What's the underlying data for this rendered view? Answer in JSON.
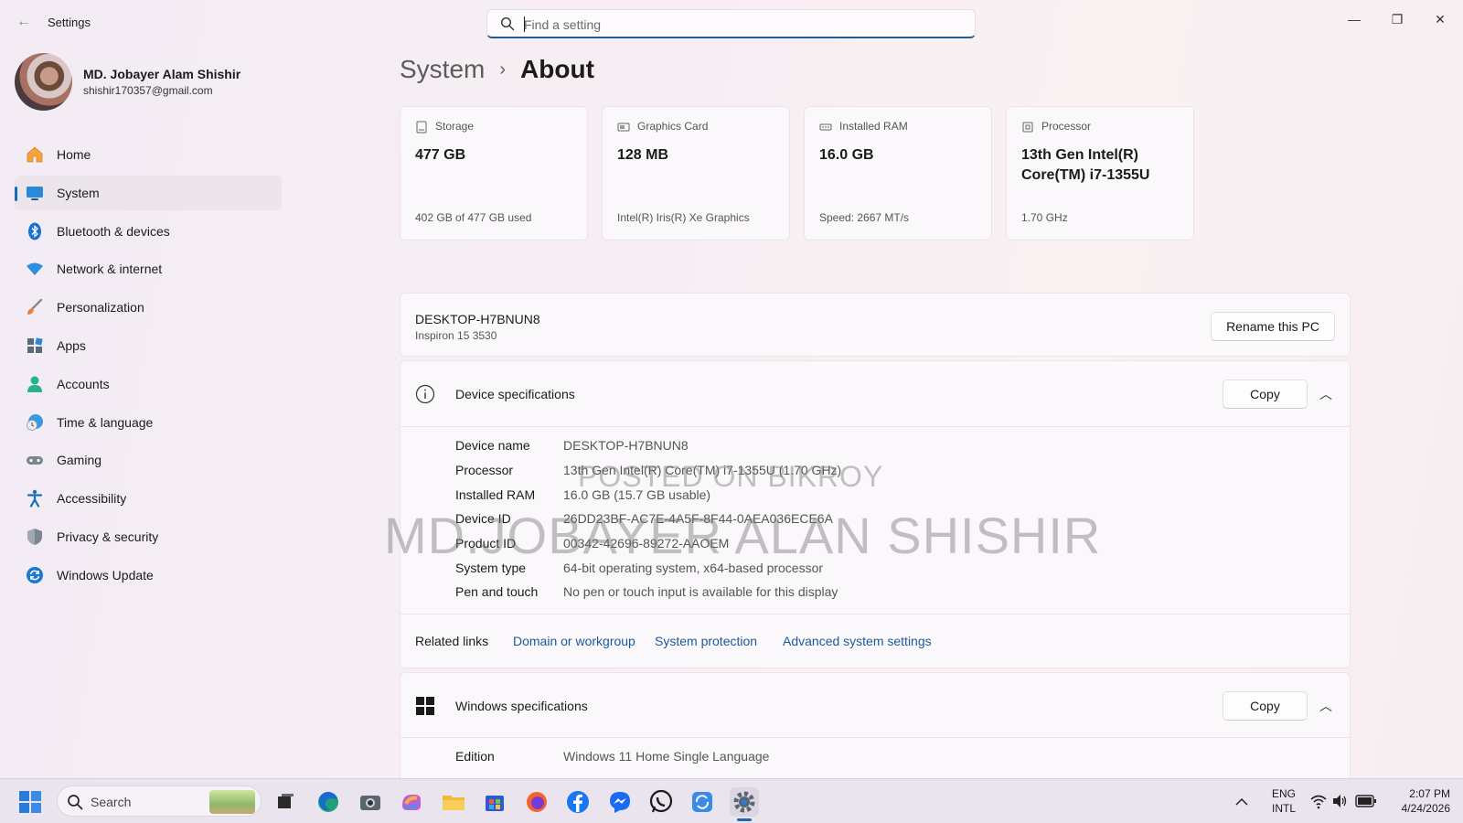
{
  "window": {
    "app_title": "Settings",
    "controls": {
      "minimize": "—",
      "maximize": "❐",
      "close": "✕"
    }
  },
  "search": {
    "placeholder": "Find a setting"
  },
  "profile": {
    "name": "MD. Jobayer Alam Shishir",
    "email": "shishir170357@gmail.com"
  },
  "sidebar": {
    "items": [
      {
        "label": "Home",
        "icon": "home-icon",
        "active": false
      },
      {
        "label": "System",
        "icon": "system-icon",
        "active": true
      },
      {
        "label": "Bluetooth & devices",
        "icon": "bluetooth-icon",
        "active": false
      },
      {
        "label": "Network & internet",
        "icon": "wifi-icon",
        "active": false
      },
      {
        "label": "Personalization",
        "icon": "brush-icon",
        "active": false
      },
      {
        "label": "Apps",
        "icon": "apps-icon",
        "active": false
      },
      {
        "label": "Accounts",
        "icon": "accounts-icon",
        "active": false
      },
      {
        "label": "Time & language",
        "icon": "clock-globe-icon",
        "active": false
      },
      {
        "label": "Gaming",
        "icon": "gamepad-icon",
        "active": false
      },
      {
        "label": "Accessibility",
        "icon": "accessibility-icon",
        "active": false
      },
      {
        "label": "Privacy & security",
        "icon": "shield-icon",
        "active": false
      },
      {
        "label": "Windows Update",
        "icon": "update-icon",
        "active": false
      }
    ]
  },
  "breadcrumb": {
    "parent": "System",
    "separator": "›",
    "current": "About"
  },
  "tiles": [
    {
      "label": "Storage",
      "icon": "storage-icon",
      "value": "477 GB",
      "sub": "402 GB of 477 GB used"
    },
    {
      "label": "Graphics Card",
      "icon": "graphics-card-icon",
      "value": "128 MB",
      "sub": "Intel(R) Iris(R) Xe Graphics"
    },
    {
      "label": "Installed RAM",
      "icon": "ram-icon",
      "value": "16.0 GB",
      "sub": "Speed: 2667 MT/s"
    },
    {
      "label": "Processor",
      "icon": "processor-icon",
      "value": "13th Gen Intel(R) Core(TM) i7-1355U",
      "sub": "1.70 GHz"
    }
  ],
  "pc": {
    "name": "DESKTOP-H7BNUN8",
    "model": "Inspiron 15 3530",
    "rename_label": "Rename this PC"
  },
  "device_specs": {
    "title": "Device specifications",
    "copy_label": "Copy",
    "rows": [
      {
        "key": "Device name",
        "value": "DESKTOP-H7BNUN8"
      },
      {
        "key": "Processor",
        "value": "13th Gen Intel(R) Core(TM) i7-1355U (1.70 GHz)"
      },
      {
        "key": "Installed RAM",
        "value": "16.0 GB (15.7 GB usable)"
      },
      {
        "key": "Device ID",
        "value": "26DD23BF-AC7E-4A5F-8F44-0AEA036ECE6A"
      },
      {
        "key": "Product ID",
        "value": "00342-42696-89272-AAOEM"
      },
      {
        "key": "System type",
        "value": "64-bit operating system, x64-based processor"
      },
      {
        "key": "Pen and touch",
        "value": "No pen or touch input is available for this display"
      }
    ]
  },
  "related_links": {
    "label": "Related links",
    "links": [
      "Domain or workgroup",
      "System protection",
      "Advanced system settings"
    ]
  },
  "windows_specs": {
    "title": "Windows specifications",
    "copy_label": "Copy",
    "rows": [
      {
        "key": "Edition",
        "value": "Windows 11 Home Single Language"
      }
    ]
  },
  "watermarks": {
    "line1": "POSTED ON BIKROY",
    "line2": "MD.JOBAYER ALAN SHISHIR"
  },
  "taskbar": {
    "search_label": "Search",
    "apps": [
      "task-view-icon",
      "edge-icon",
      "camera-icon",
      "copilot-icon",
      "file-explorer-icon",
      "store-icon",
      "firefox-icon",
      "facebook-icon",
      "messenger-icon",
      "whatsapp-icon",
      "sync-icon",
      "settings-icon"
    ],
    "lang_line1": "ENG",
    "lang_line2": "INTL",
    "time": "2:07 PM",
    "date": "4/24/2026"
  },
  "colors": {
    "accent": "#1a6bb5",
    "link": "#1a5a9a"
  }
}
